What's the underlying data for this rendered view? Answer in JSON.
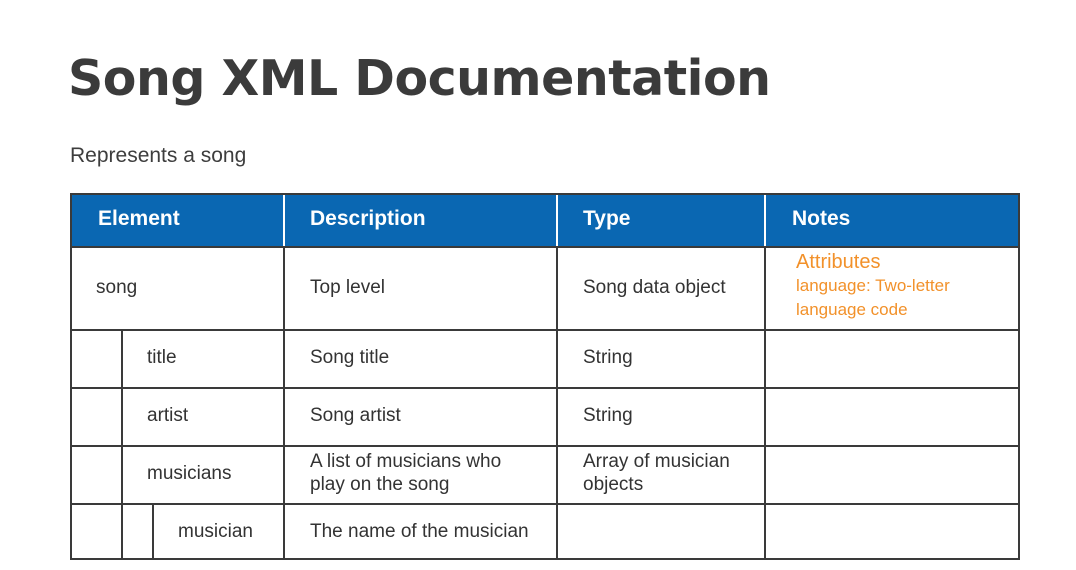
{
  "title": "Song XML Documentation",
  "subtitle": "Represents a song",
  "table": {
    "headers": [
      "Element",
      "Description",
      "Type",
      "Notes"
    ],
    "rows": [
      {
        "element": "song",
        "description": "Top level",
        "type": "Song data object",
        "notes_heading": "Attributes",
        "notes_line1": "language: Two-letter",
        "notes_line2": "language code"
      },
      {
        "element": "title",
        "description": "Song title",
        "type": "String"
      },
      {
        "element": "artist",
        "description": "Song artist",
        "type": "String"
      },
      {
        "element": "musicians",
        "description_line1": "A list of musicians who",
        "description_line2": "play on the song",
        "type_line1": "Array of musician",
        "type_line2": "objects"
      },
      {
        "element": "musician",
        "description": "The name of the musician",
        "type": ""
      }
    ]
  },
  "colors": {
    "header_background": "#0a67b2",
    "header_text": "#ffffff",
    "notes_text": "#f2912a",
    "border": "#3a3a3a"
  }
}
